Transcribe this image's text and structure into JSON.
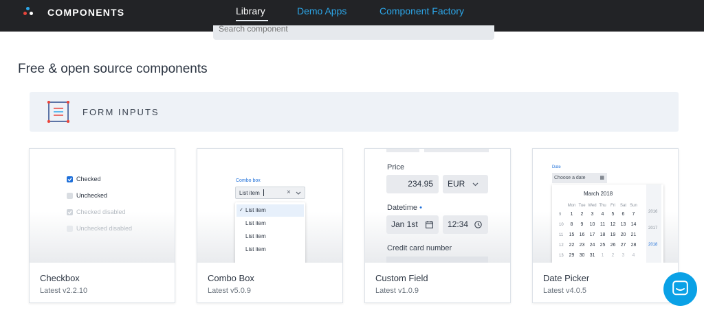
{
  "app": {
    "brand": "COMPONENTS",
    "colors": {
      "accent": "#2ca6e8",
      "topbar": "#222326",
      "fab": "#0aa1e6",
      "logo_dot_1": "#2ca6e8",
      "logo_dot_2": "#e8453c",
      "logo_dot_3": "#ffffff"
    }
  },
  "nav": {
    "library": "Library",
    "demo_apps": "Demo Apps",
    "component_factory": "Component Factory"
  },
  "search": {
    "placeholder": "Search component"
  },
  "main": {
    "headline": "Free & open source components",
    "section": {
      "title": "FORM INPUTS",
      "icon": "form-inputs-icon"
    }
  },
  "cards": [
    {
      "name": "Checkbox",
      "version": "Latest v2.2.10",
      "preview": {
        "items": [
          {
            "label": "Checked",
            "state": "checked"
          },
          {
            "label": "Unchecked",
            "state": "unchecked"
          },
          {
            "label": "Checked disabled",
            "state": "checked-disabled"
          },
          {
            "label": "Unchecked disabled",
            "state": "unchecked-disabled"
          }
        ]
      }
    },
    {
      "name": "Combo Box",
      "version": "Latest v5.0.9",
      "preview": {
        "label": "Combo box",
        "value": "List item",
        "items": [
          "List item",
          "List item",
          "List item",
          "List item"
        ]
      }
    },
    {
      "name": "Custom Field",
      "version": "Latest v1.0.9",
      "preview": {
        "price_label": "Price",
        "price_value": "234.95",
        "currency": "EUR",
        "datetime_label": "Datetime",
        "required_mark": "•",
        "date_value": "Jan 1st",
        "time_value": "12:34",
        "card_label": "Credit card number"
      }
    },
    {
      "name": "Date Picker",
      "version": "Latest v4.0.5",
      "preview": {
        "label": "Date",
        "placeholder": "Choose a date",
        "month": "March 2018",
        "weekdays": [
          "Mon",
          "Tue",
          "Wed",
          "Thu",
          "Fri",
          "Sat",
          "Sun"
        ],
        "weeks": [
          {
            "wk": "9",
            "days": [
              "1",
              "2",
              "3",
              "4",
              "5",
              "6",
              "7"
            ]
          },
          {
            "wk": "10",
            "days": [
              "8",
              "9",
              "10",
              "11",
              "12",
              "13",
              "14"
            ]
          },
          {
            "wk": "11",
            "days": [
              "15",
              "16",
              "17",
              "18",
              "19",
              "20",
              "21"
            ]
          },
          {
            "wk": "12",
            "days": [
              "22",
              "23",
              "24",
              "25",
              "26",
              "27",
              "28"
            ]
          },
          {
            "wk": "13",
            "days": [
              "29",
              "30",
              "31",
              "1",
              "2",
              "3",
              "4"
            ]
          }
        ],
        "years": [
          "2016",
          "2017",
          "2018"
        ]
      }
    }
  ]
}
